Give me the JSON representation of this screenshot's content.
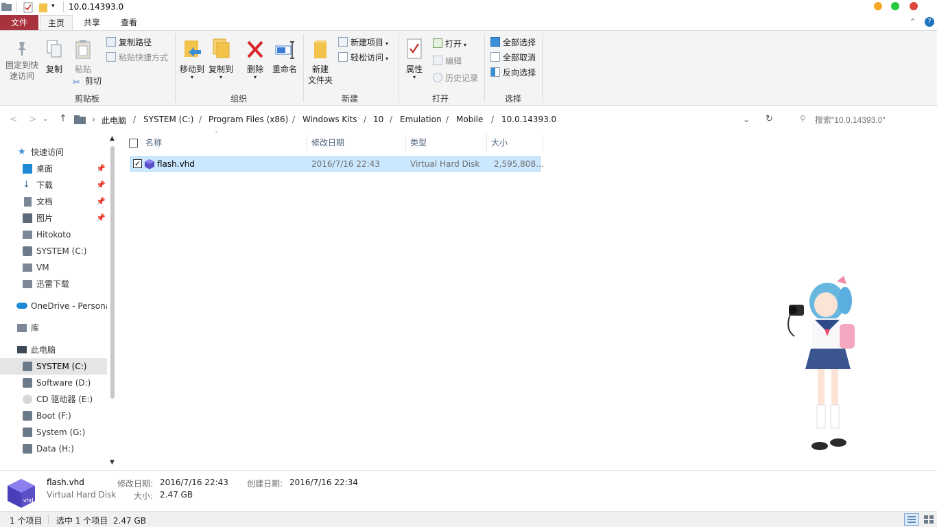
{
  "window": {
    "title": "10.0.14393.0"
  },
  "tabs": {
    "file": "文件",
    "home": "主页",
    "share": "共享",
    "view": "查看"
  },
  "ribbon": {
    "clipboard": {
      "label": "剪贴板",
      "pin_quick_access": "固定到快速访问",
      "copy": "复制",
      "paste": "粘贴",
      "copy_path": "复制路径",
      "paste_shortcut": "粘贴快捷方式",
      "cut": "剪切"
    },
    "organize": {
      "label": "组织",
      "move_to": "移动到",
      "copy_to": "复制到",
      "delete": "删除",
      "rename": "重命名"
    },
    "new": {
      "label": "新建",
      "new_folder_l1": "新建",
      "new_folder_l2": "文件夹",
      "new_item": "新建项目",
      "easy_access": "轻松访问"
    },
    "open": {
      "label": "打开",
      "properties": "属性",
      "open": "打开",
      "edit": "编辑",
      "history": "历史记录"
    },
    "select": {
      "label": "选择",
      "select_all": "全部选择",
      "select_none": "全部取消",
      "invert": "反向选择"
    }
  },
  "address": {
    "crumbs": [
      "此电脑",
      "SYSTEM (C:)",
      "Program Files (x86)",
      "Windows Kits",
      "10",
      "Emulation",
      "Mobile",
      "10.0.14393.0"
    ],
    "search_placeholder": "搜索\"10.0.14393.0\""
  },
  "nav": {
    "quick_access": "快速访问",
    "items": [
      {
        "label": "桌面"
      },
      {
        "label": "下载"
      },
      {
        "label": "文档"
      },
      {
        "label": "图片"
      },
      {
        "label": "Hitokoto"
      },
      {
        "label": "SYSTEM (C:)"
      },
      {
        "label": "VM"
      },
      {
        "label": "迅雷下载"
      }
    ],
    "onedrive": "OneDrive - Persona",
    "library": "库",
    "this_pc": "此电脑",
    "drives": [
      {
        "label": "SYSTEM (C:)"
      },
      {
        "label": "Software (D:)"
      },
      {
        "label": "CD 驱动器 (E:)"
      },
      {
        "label": "Boot (F:)"
      },
      {
        "label": "System (G:)"
      },
      {
        "label": "Data (H:)"
      }
    ]
  },
  "columns": {
    "name": "名称",
    "modified": "修改日期",
    "type": "类型",
    "size": "大小"
  },
  "files": [
    {
      "name": "flash.vhd",
      "modified": "2016/7/16 22:43",
      "type": "Virtual Hard Disk",
      "size": "2,595,808..."
    }
  ],
  "details": {
    "name": "flash.vhd",
    "type": "Virtual Hard Disk",
    "icon_label": "vhd",
    "modified_label": "修改日期:",
    "modified": "2016/7/16 22:43",
    "created_label": "创建日期:",
    "created": "2016/7/16 22:34",
    "size_label": "大小:",
    "size": "2.47 GB"
  },
  "status": {
    "count": "1 个项目",
    "selected": "选中 1 个项目  2.47 GB"
  },
  "colors": {
    "file_tab": "#a8323e",
    "selection": "#cce8ff",
    "selection_border": "#99d1ff",
    "folder": "#f3c24b"
  }
}
